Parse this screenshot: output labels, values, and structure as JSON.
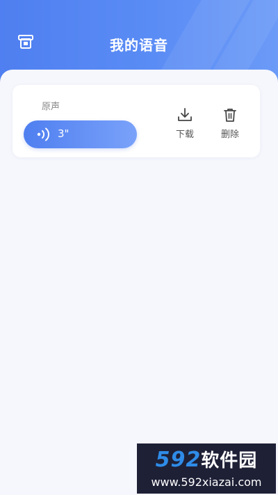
{
  "header": {
    "title": "我的语音",
    "left_icon": "printer-icon"
  },
  "voice_item": {
    "label": "原声",
    "duration": "3\"",
    "play_icon": "sound-wave-icon"
  },
  "actions": {
    "download_label": "下载",
    "download_icon": "download-icon",
    "delete_label": "删除",
    "delete_icon": "trash-icon"
  },
  "watermark": {
    "brand_number": "592",
    "brand_text": "软件园",
    "url": "www.592xiazai.com"
  },
  "colors": {
    "accent": "#4f7ff0",
    "background": "#f6f7fc",
    "card": "#ffffff"
  }
}
